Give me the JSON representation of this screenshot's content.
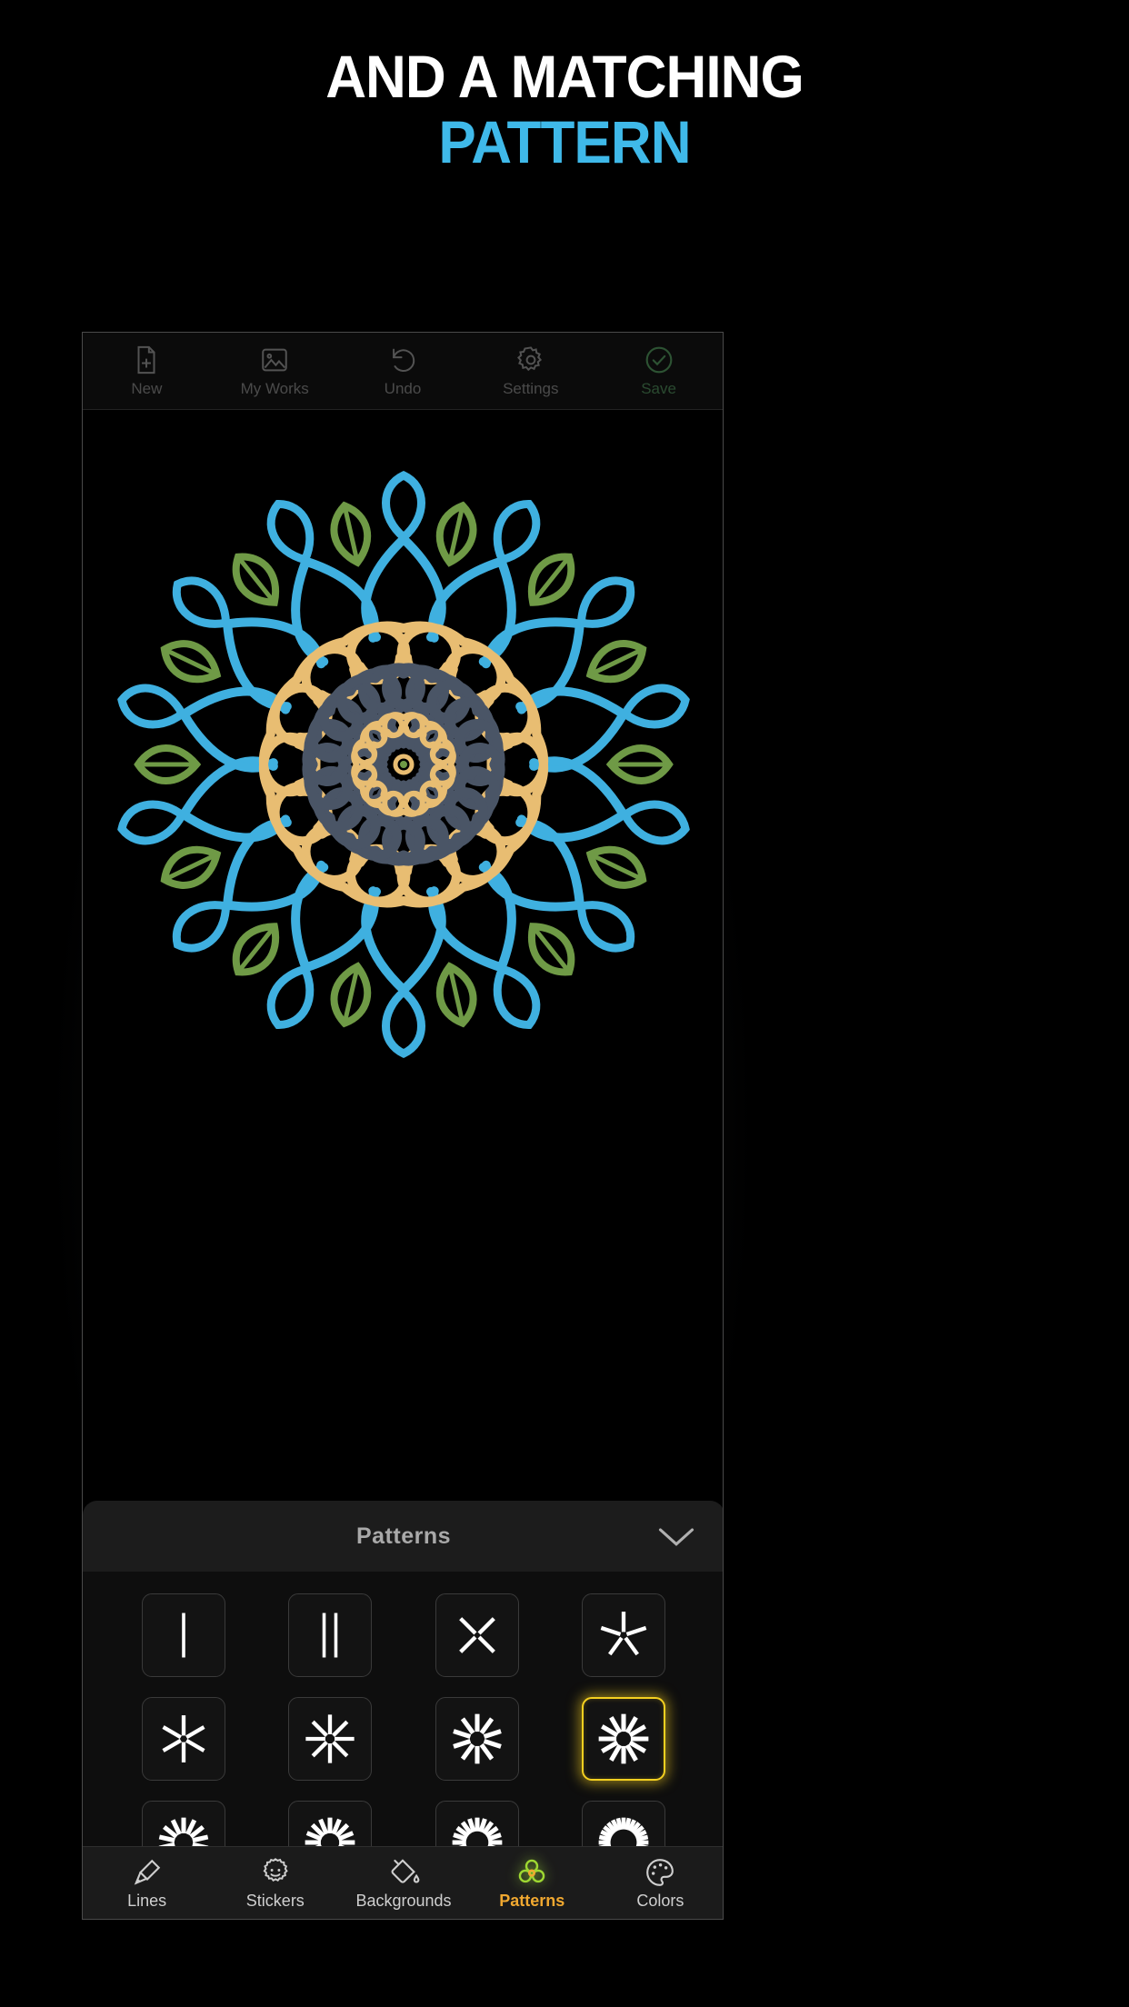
{
  "promo": {
    "line1": "AND A MATCHING",
    "line2": "PATTERN",
    "line1_color": "#ffffff",
    "line2_color": "#3fb9e9"
  },
  "toolbar": {
    "items": [
      {
        "label": "New",
        "icon": "new-document-icon"
      },
      {
        "label": "My Works",
        "icon": "gallery-image-icon"
      },
      {
        "label": "Undo",
        "icon": "undo-arrow-icon"
      },
      {
        "label": "Settings",
        "icon": "gear-icon"
      },
      {
        "label": "Save",
        "icon": "check-circle-icon",
        "color": "#4a8a55"
      }
    ]
  },
  "canvas": {
    "artwork_name": "mandala-drawing",
    "stroke_colors": [
      "#3fb0e0",
      "#e8bd72",
      "#6f9a46",
      "#4a5566"
    ],
    "background": "#000000"
  },
  "panel": {
    "title": "Patterns",
    "collapse_icon": "chevron-down-icon",
    "selected_index": 7,
    "tiles": [
      {
        "name": "pattern-1-axis",
        "spokes": 1,
        "style": "line"
      },
      {
        "name": "pattern-2-axis",
        "spokes": 2,
        "style": "line"
      },
      {
        "name": "pattern-4-axis",
        "spokes": 4,
        "style": "cross"
      },
      {
        "name": "pattern-5-axis",
        "spokes": 5,
        "style": "star"
      },
      {
        "name": "pattern-6-axis",
        "spokes": 6,
        "style": "star"
      },
      {
        "name": "pattern-8-axis",
        "spokes": 8,
        "style": "star"
      },
      {
        "name": "pattern-10-axis",
        "spokes": 10,
        "style": "burst"
      },
      {
        "name": "pattern-12-axis",
        "spokes": 12,
        "style": "burst"
      },
      {
        "name": "pattern-14-axis",
        "spokes": 14,
        "style": "burst"
      },
      {
        "name": "pattern-16-axis",
        "spokes": 16,
        "style": "burst"
      },
      {
        "name": "pattern-20-axis",
        "spokes": 20,
        "style": "burst"
      },
      {
        "name": "pattern-28-axis",
        "spokes": 28,
        "style": "burst"
      }
    ]
  },
  "nav": {
    "active": "Patterns",
    "active_color": "#f0a830",
    "items": [
      {
        "label": "Lines",
        "icon": "paintbrush-icon"
      },
      {
        "label": "Stickers",
        "icon": "smiley-sticker-icon"
      },
      {
        "label": "Backgrounds",
        "icon": "paint-bucket-icon"
      },
      {
        "label": "Patterns",
        "icon": "flower-pattern-icon"
      },
      {
        "label": "Colors",
        "icon": "palette-icon"
      }
    ]
  }
}
